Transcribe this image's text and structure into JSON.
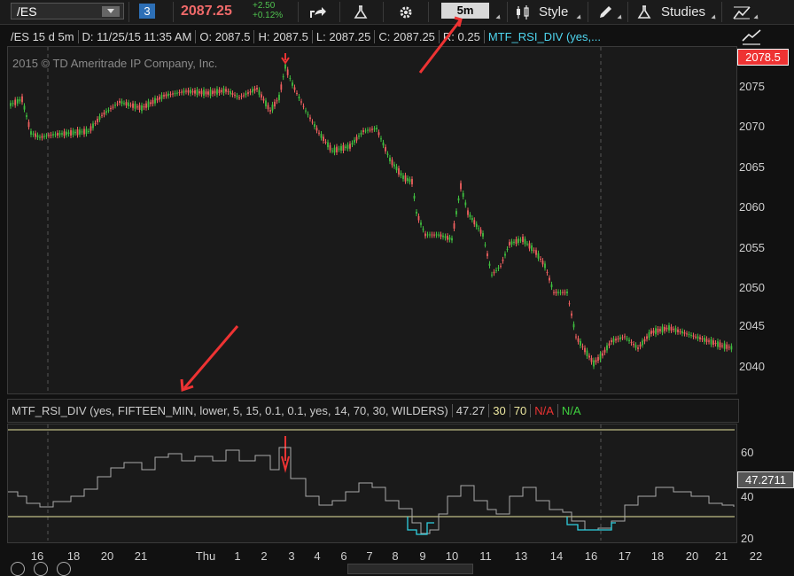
{
  "toolbar": {
    "symbol": "/ES",
    "link_badge": "3",
    "last_price": "2087.25",
    "net_change": "+2.50",
    "pct_change": "+0.12%",
    "timeframe": "5m",
    "style_label": "Style",
    "studies_label": "Studies",
    "icons": [
      "share-icon",
      "flask-icon",
      "gear-icon",
      "candlestick-icon",
      "pencil-icon",
      "studies-flask-icon",
      "drawing-tools-icon"
    ]
  },
  "info": {
    "title": "/ES 15 d 5m",
    "date": "D: 11/25/15 11:35 AM",
    "open": "O: 2087.5",
    "high": "H: 2087.5",
    "low": "L: 2087.25",
    "close": "C: 2087.25",
    "range": "R: 0.25",
    "study": "MTF_RSI_DIV (yes,..."
  },
  "watermark": "2015 © TD Ameritrade IP Company, Inc.",
  "price_axis": [
    "2075",
    "2070",
    "2065",
    "2060",
    "2055",
    "2050",
    "2045",
    "2040"
  ],
  "current_price_tag": "2078.5",
  "rsi": {
    "label": "MTF_RSI_DIV (yes, FIFTEEN_MIN, lower, 5, 15, 0.1, 0.1, yes, 14, 70, 30, WILDERS)",
    "value": "47.27",
    "ob": "30",
    "os": "70",
    "na1": "N/A",
    "na2": "N/A",
    "axis": [
      "60",
      "40",
      "20"
    ],
    "tag": "47.2711"
  },
  "time_axis": [
    "16",
    "18",
    "20",
    "21",
    "Thu",
    "1",
    "2",
    "3",
    "4",
    "6",
    "7",
    "8",
    "9",
    "10",
    "11",
    "13",
    "14",
    "16",
    "17",
    "18",
    "20",
    "21",
    "22"
  ],
  "colors": {
    "up": "#3fbf3f",
    "down": "#ef5f5f",
    "rsi": "#a9a9a9",
    "rsi_low": "#2fd0e0",
    "level": "#e8e6a0",
    "arrow": "#ee3333"
  }
}
